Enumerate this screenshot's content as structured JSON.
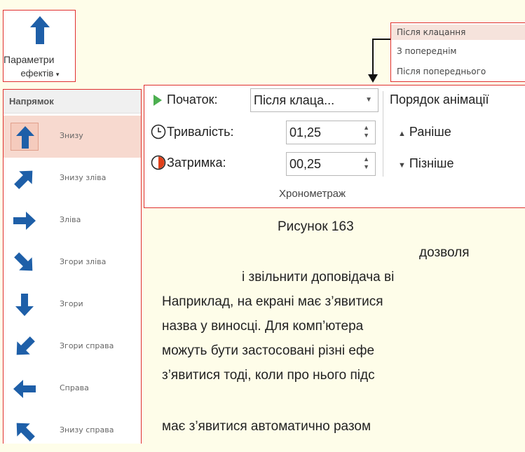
{
  "effect_options": {
    "line1": "Параметри",
    "line2": "ефектів",
    "caret": "▾"
  },
  "direction": {
    "header": "Напрямок",
    "items": [
      {
        "label": "Знизу",
        "icon": "arrow-up-icon",
        "selected": true
      },
      {
        "label": "Знизу зліва",
        "icon": "arrow-up-right-icon"
      },
      {
        "label": "Зліва",
        "icon": "arrow-right-icon"
      },
      {
        "label": "Згори зліва",
        "icon": "arrow-down-right-icon"
      },
      {
        "label": "Згори",
        "icon": "arrow-down-icon"
      },
      {
        "label": "Згори справа",
        "icon": "arrow-down-left-icon"
      },
      {
        "label": "Справа",
        "icon": "arrow-left-icon"
      },
      {
        "label": "Знизу справа",
        "icon": "arrow-up-left-icon"
      }
    ]
  },
  "dropdown": {
    "options": [
      "Після клацання",
      "З попереднім",
      "Після попереднього"
    ]
  },
  "timing": {
    "start_label": "Початок:",
    "start_value": "Після клаца...",
    "duration_label": "Тривалість:",
    "duration_value": "01,25",
    "delay_label": "Затримка:",
    "delay_value": "00,25",
    "group_label": "Хронометраж",
    "order_title": "Порядок анімації",
    "earlier": "Раніше",
    "later": "Пізніше"
  },
  "caption": "Рисунок 163",
  "body_lines": [
    "дозволя",
    "і звільнити доповідача ві",
    "Наприклад, на екрані має з’явитися",
    "назва  у  виносці.  Для  комп’ютера",
    "можуть бути застосовані різні ефе",
    "з’явитися тоді, коли про нього підс",
    "має з’явитися автоматично разом"
  ],
  "colors": {
    "accent": "#e03030",
    "arrow_blue": "#1e5fa8",
    "play_green": "#4caf50"
  }
}
